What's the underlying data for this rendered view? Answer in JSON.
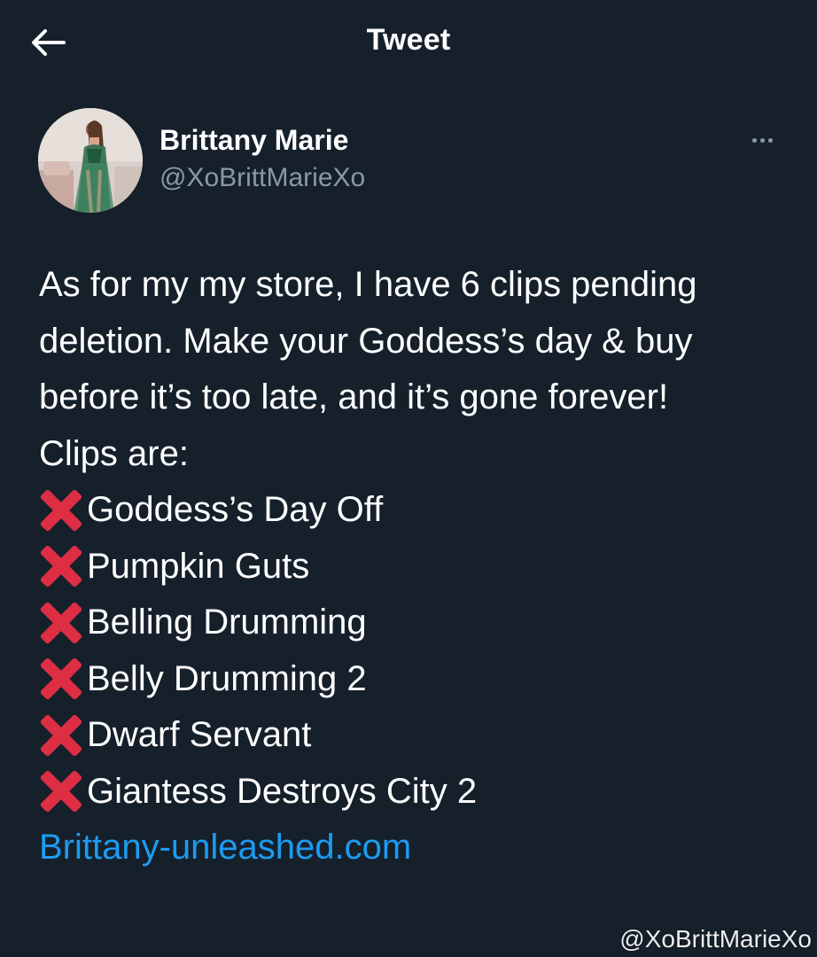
{
  "header": {
    "title": "Tweet",
    "back_icon": "arrow-left-icon"
  },
  "author": {
    "name": "Brittany Marie",
    "handle": "@XoBrittMarieXo",
    "more_icon": "more-horizontal-icon"
  },
  "tweet": {
    "paragraph": "As for my my store, I have 6 clips pending deletion. Make your Goddess’s day & buy before it’s too late, and it’s gone forever!",
    "clips_heading": "Clips are:",
    "clip_marker_icon": "cross-mark-icon",
    "clips": [
      {
        "title": "Goddess’s Day Off"
      },
      {
        "title": "Pumpkin Guts"
      },
      {
        "title": "Belling Drumming"
      },
      {
        "title": "Belly Drumming 2"
      },
      {
        "title": "Dwarf Servant"
      },
      {
        "title": "Giantess Destroys City 2"
      }
    ],
    "link": "Brittany-unleashed.com"
  },
  "watermark": "@XoBrittMarieXo",
  "colors": {
    "background": "#15202b",
    "text": "#ffffff",
    "secondary_text": "#8b98a5",
    "link": "#1d9bf0",
    "cross_mark": "#dd2e44"
  }
}
